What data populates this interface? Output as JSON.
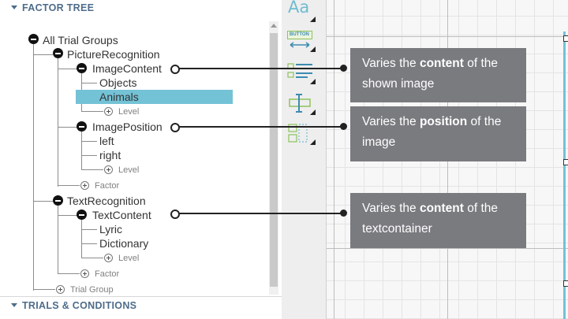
{
  "factor_tree": {
    "header": "FACTOR TREE",
    "root": "All Trial Groups",
    "picture_recognition": {
      "label": "PictureRecognition",
      "image_content": {
        "label": "ImageContent",
        "levels": [
          "Objects",
          "Animals"
        ],
        "selected_level": "Animals",
        "add_level": "Level"
      },
      "image_position": {
        "label": "ImagePosition",
        "levels": [
          "left",
          "right"
        ],
        "add_level": "Level"
      },
      "add_factor": "Factor"
    },
    "text_recognition": {
      "label": "TextRecognition",
      "text_content": {
        "label": "TextContent",
        "levels": [
          "Lyric",
          "Dictionary"
        ],
        "add_level": "Level"
      },
      "add_factor": "Factor"
    },
    "add_trial_group": "Trial Group"
  },
  "trials_conditions": {
    "header": "TRIALS & CONDITIONS"
  },
  "toolbox": {
    "text_tool_glyph": "Aa",
    "button_tool_label": "BUTTON"
  },
  "callouts": [
    {
      "pre": "Varies the ",
      "bold": "content",
      "post": " of the shown image"
    },
    {
      "pre": "Varies the ",
      "bold": "position",
      "post": " of the image"
    },
    {
      "pre": "Varies the ",
      "bold": "content",
      "post": " of the textcontainer"
    }
  ],
  "colors": {
    "selection": "#74c2d6",
    "header_text": "#4e6c8a",
    "callout_bg": "#7a7b7f",
    "toolbox_bg": "#eeeeee"
  }
}
